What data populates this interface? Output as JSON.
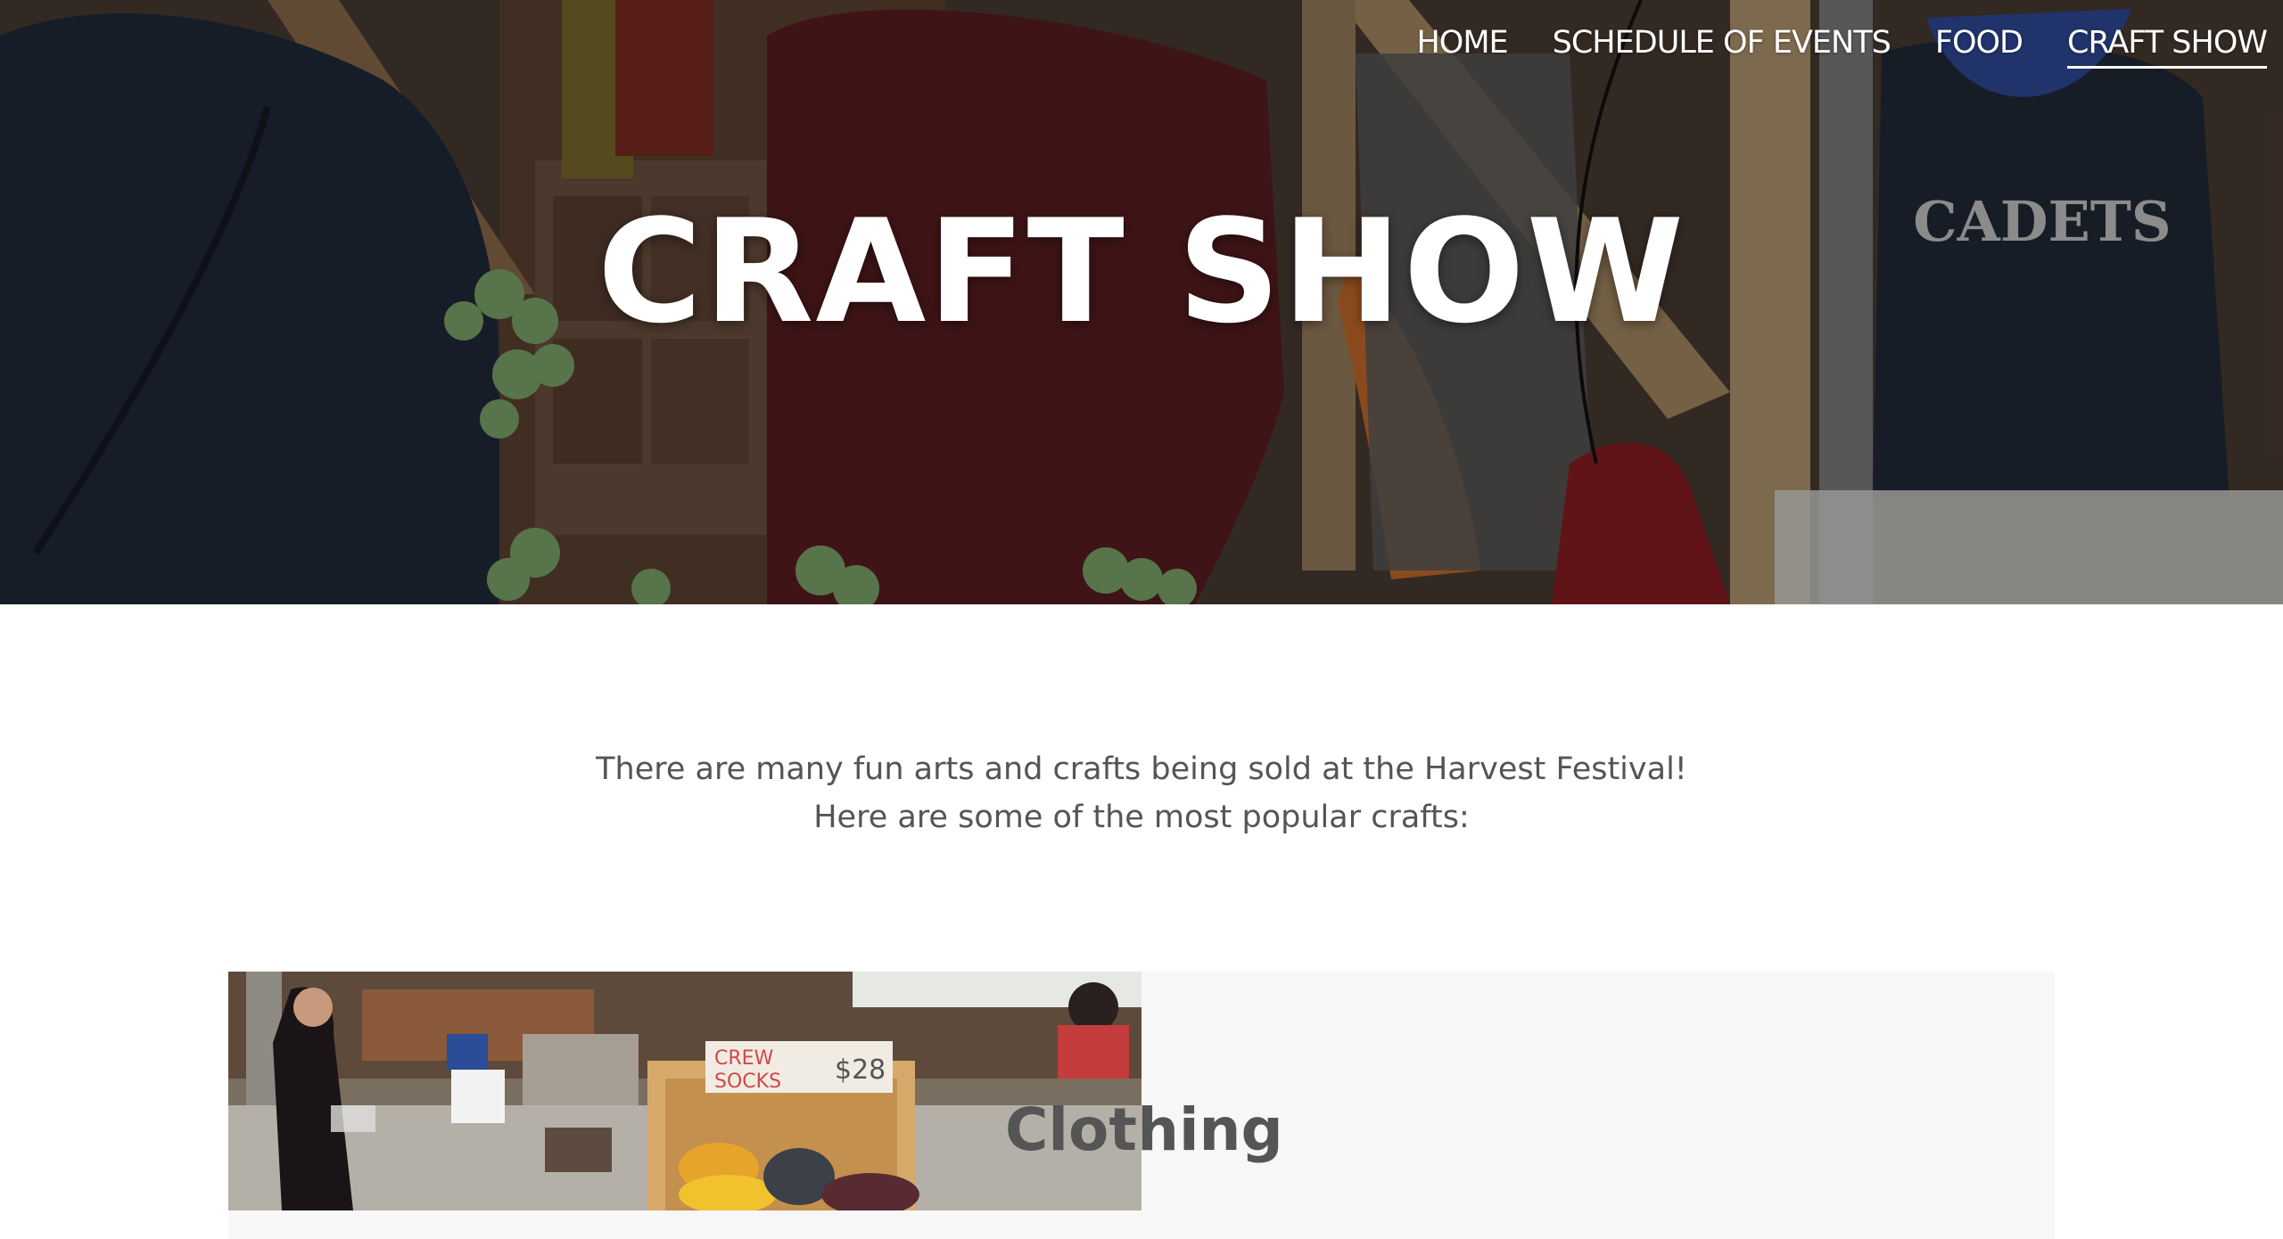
{
  "nav": {
    "items": [
      {
        "label": "HOME",
        "active": false
      },
      {
        "label": "SCHEDULE OF EVENTS",
        "active": false
      },
      {
        "label": "FOOD",
        "active": false
      },
      {
        "label": "CRAFT SHOW",
        "active": true
      }
    ]
  },
  "hero": {
    "title": "CRAFT SHOW",
    "photo_shirt_text": "CADETS"
  },
  "intro": {
    "line1": "There are many fun arts and crafts being sold at the Harvest Festival!",
    "line2": "Here are some of the most popular crafts:"
  },
  "crafts": [
    {
      "title": "Clothing",
      "photo_sign_line1": "CREW",
      "photo_sign_line2": "SOCKS",
      "photo_sign_price": "$28"
    }
  ],
  "colors": {
    "text_gray": "#555555",
    "card_bg": "#f7f7f7",
    "nav_text": "#ffffff"
  }
}
